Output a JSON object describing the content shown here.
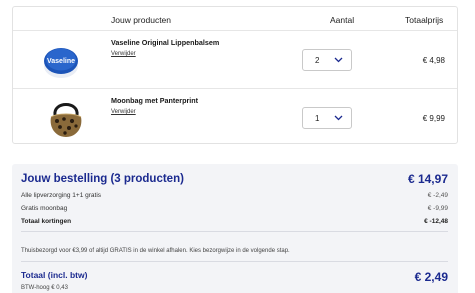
{
  "cart": {
    "headers": {
      "products": "Jouw producten",
      "quantity": "Aantal",
      "total": "Totaalprijs"
    },
    "items": [
      {
        "name": "Vaseline Original Lippenbalsem",
        "remove_label": "Verwijder",
        "quantity": "2",
        "price": "€ 4,98",
        "image": "vaseline-tin-icon"
      },
      {
        "name": "Moonbag met Panterprint",
        "remove_label": "Verwijder",
        "quantity": "1",
        "price": "€ 9,99",
        "image": "leopard-beltbag-icon"
      }
    ]
  },
  "summary": {
    "title": "Jouw bestelling (3 producten)",
    "title_amount": "€ 14,97",
    "lines": [
      {
        "label": "Alle lipverzorging 1+1 gratis",
        "amount": "€ -2,49"
      },
      {
        "label": "Gratis moonbag",
        "amount": "€ -9,99"
      },
      {
        "label": "Totaal kortingen",
        "amount": "€ -12,48"
      }
    ],
    "info": "Thuisbezorgd voor €3,99 of altijd GRATIS in de winkel afhalen. Kies bezorgwijze in de volgende stap.",
    "total_label": "Totaal (incl. btw)",
    "total_amount": "€ 2,49",
    "btw": "BTW-hoog € 0,43"
  },
  "colors": {
    "accent": "#1b2a8f",
    "summary_bg": "#f3f4f7",
    "border": "#e2e2e2"
  }
}
